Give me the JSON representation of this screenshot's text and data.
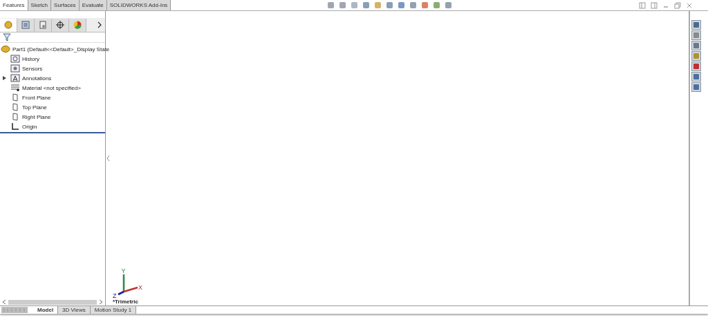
{
  "command_tabs": [
    {
      "label": "Features",
      "selected": true
    },
    {
      "label": "Sketch",
      "selected": false
    },
    {
      "label": "Surfaces",
      "selected": false
    },
    {
      "label": "Evaluate",
      "selected": false
    },
    {
      "label": "SOLIDWORKS Add-Ins",
      "selected": false
    }
  ],
  "panel_tabs": [
    {
      "kind": "feature",
      "selected": true
    },
    {
      "kind": "property",
      "selected": false
    },
    {
      "kind": "config",
      "selected": false
    },
    {
      "kind": "dimxpert",
      "selected": false
    },
    {
      "kind": "display",
      "selected": false
    }
  ],
  "tree": {
    "root": "Part1  (Default<<Default>_Display State",
    "items": [
      {
        "label": "History",
        "kind": "history"
      },
      {
        "label": "Sensors",
        "kind": "sensors"
      },
      {
        "label": "Annotations",
        "kind": "annotations",
        "expanded": false
      },
      {
        "label": "Material <not specified>",
        "kind": "material"
      },
      {
        "label": "Front Plane",
        "kind": "plane"
      },
      {
        "label": "Top Plane",
        "kind": "plane"
      },
      {
        "label": "Right Plane",
        "kind": "plane"
      },
      {
        "label": "Origin",
        "kind": "origin"
      }
    ]
  },
  "viewport": {
    "view_name": "*Trimetric",
    "axes": [
      "X",
      "Y",
      "Z"
    ]
  },
  "bottom_tabs": [
    {
      "label": "Model",
      "selected": true
    },
    {
      "label": "3D Views",
      "selected": false
    },
    {
      "label": "Motion Study 1",
      "selected": false
    }
  ]
}
